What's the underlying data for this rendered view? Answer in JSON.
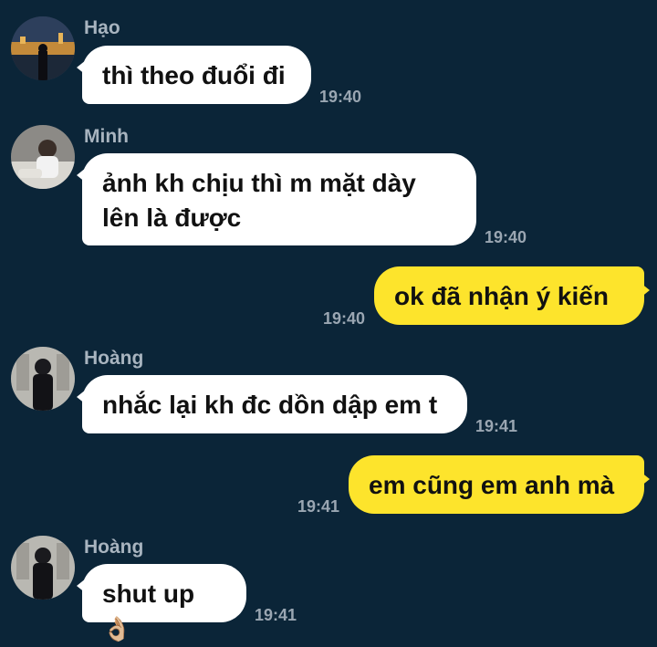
{
  "messages": [
    {
      "sender": "Hạo",
      "text": "thì theo đuổi đi",
      "time": "19:40",
      "avatar_icon": "city-night-photo-icon"
    },
    {
      "sender": "Minh",
      "text_line1": "ảnh kh chịu thì m mặt dày",
      "text_line2": "lên là được",
      "time": "19:40",
      "avatar_icon": "person-sitting-photo-icon"
    },
    {
      "text": "ok đã nhận ý kiến",
      "time": "19:40"
    },
    {
      "sender": "Hoàng",
      "text": "nhắc lại kh đc dồn dập em t",
      "time": "19:41",
      "avatar_icon": "person-standing-photo-icon"
    },
    {
      "text": "em cũng em anh mà",
      "time": "19:41"
    },
    {
      "sender": "Hoàng",
      "text": "shut up",
      "emoji": "👌🏼",
      "time": "19:41",
      "avatar_icon": "person-standing-photo-icon"
    }
  ],
  "colors": {
    "background": "#0b2538",
    "incoming_bubble": "#ffffff",
    "outgoing_bubble": "#fde42c"
  }
}
